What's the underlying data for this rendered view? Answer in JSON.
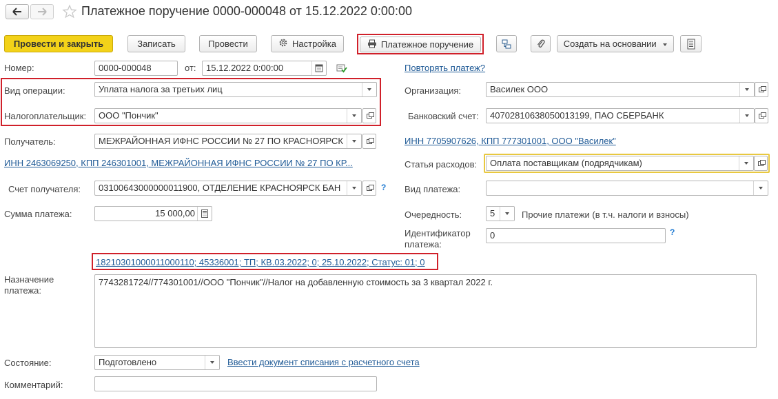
{
  "window": {
    "title": "Платежное поручение 0000-000048 от 15.12.2022 0:00:00",
    "nav_back_icon": "arrow-left-icon",
    "nav_forward_icon": "arrow-right-icon",
    "favorite_icon": "star-icon"
  },
  "toolbar": {
    "post_close": "Провести и закрыть",
    "save": "Записать",
    "post": "Провести",
    "settings": "Настройка",
    "print_payment_order": "Платежное поручение",
    "create_based_on": "Создать на основании"
  },
  "form": {
    "number_label": "Номер:",
    "number_value": "0000-000048",
    "date_label": "от:",
    "date_value": "15.12.2022  0:00:00",
    "repeat_link": "Повторять платеж?",
    "operation_label": "Вид операции:",
    "operation_value": "Уплата налога за третьих лиц",
    "taxpayer_label": "Налогоплательщик:",
    "taxpayer_value": "ООО \"Пончик\"",
    "recipient_label": "Получатель:",
    "recipient_value": "МЕЖРАЙОННАЯ ИФНС РОССИИ № 27 ПО КРАСНОЯРСК",
    "recipient_inn_link": "ИНН 2463069250, КПП 246301001, МЕЖРАЙОННАЯ ИФНС РОССИИ № 27 ПО КР...",
    "recipient_account_label": "Счет получателя:",
    "recipient_account_value": "03100643000000011900, ОТДЕЛЕНИЕ КРАСНОЯРСК БАН",
    "amount_label": "Сумма платежа:",
    "amount_value": "15 000,00",
    "org_label": "Организация:",
    "org_value": "Василек ООО",
    "bank_account_label": "Банковский счет:",
    "bank_account_value": "40702810638050013199, ПАО СБЕРБАНК",
    "org_inn_link": "ИНН 7705907626, КПП 777301001, ООО \"Василек\"",
    "expense_label": "Статья расходов:",
    "expense_value": "Оплата поставщикам (подрядчикам)",
    "payment_type_label": "Вид платежа:",
    "payment_type_value": "",
    "priority_label": "Очередность:",
    "priority_value": "5",
    "priority_desc": "Прочие платежи (в т.ч. налоги и взносы)",
    "identifier_label_1": "Идентификатор",
    "identifier_label_2": "платежа:",
    "identifier_value": "0",
    "tax_details_link": "18210301000011000110; 45336001; ТП; КВ.03.2022; 0; 25.10.2022; Статус: 01; 0",
    "purpose_label_1": "Назначение",
    "purpose_label_2": "платежа:",
    "purpose_value": "7743281724//774301001//ООО \"Пончик\"//Налог на добавленную стоимость за 3 квартал 2022 г.",
    "state_label": "Состояние:",
    "state_value": "Подготовлено",
    "debit_link": "Ввести документ списания с расчетного счета",
    "comment_label": "Комментарий:",
    "comment_value": "",
    "help_mark": "?"
  },
  "colors": {
    "primary_button": "#f3d219",
    "highlight_red": "#d0202a",
    "highlight_yellow": "#e8c840",
    "link": "#1f5a96"
  }
}
